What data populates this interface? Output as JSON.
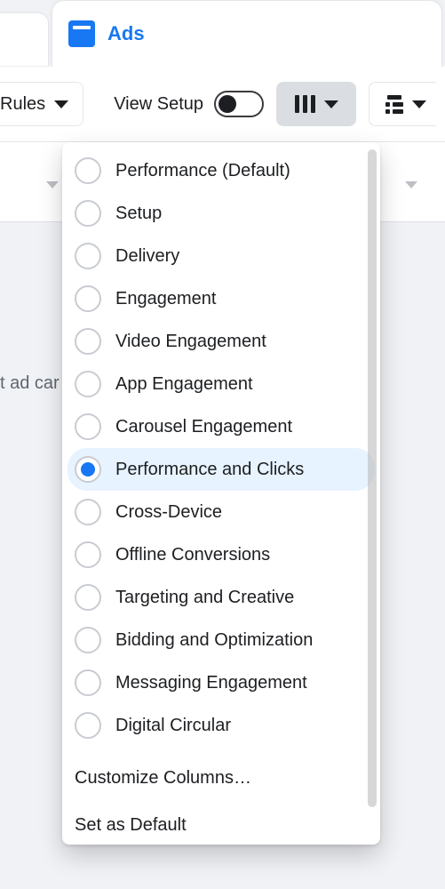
{
  "tab": {
    "label": "Ads"
  },
  "toolbar": {
    "rules_label": "Rules",
    "view_setup_label": "View Setup"
  },
  "content": {
    "hint_text": "t ad car"
  },
  "dropdown": {
    "items": [
      {
        "label": "Performance (Default)",
        "selected": false
      },
      {
        "label": "Setup",
        "selected": false
      },
      {
        "label": "Delivery",
        "selected": false
      },
      {
        "label": "Engagement",
        "selected": false
      },
      {
        "label": "Video Engagement",
        "selected": false
      },
      {
        "label": "App Engagement",
        "selected": false
      },
      {
        "label": "Carousel Engagement",
        "selected": false
      },
      {
        "label": "Performance and Clicks",
        "selected": true
      },
      {
        "label": "Cross-Device",
        "selected": false
      },
      {
        "label": "Offline Conversions",
        "selected": false
      },
      {
        "label": "Targeting and Creative",
        "selected": false
      },
      {
        "label": "Bidding and Optimization",
        "selected": false
      },
      {
        "label": "Messaging Engagement",
        "selected": false
      },
      {
        "label": "Digital Circular",
        "selected": false
      }
    ],
    "customize_label": "Customize Columns…",
    "default_label": "Set as Default"
  }
}
